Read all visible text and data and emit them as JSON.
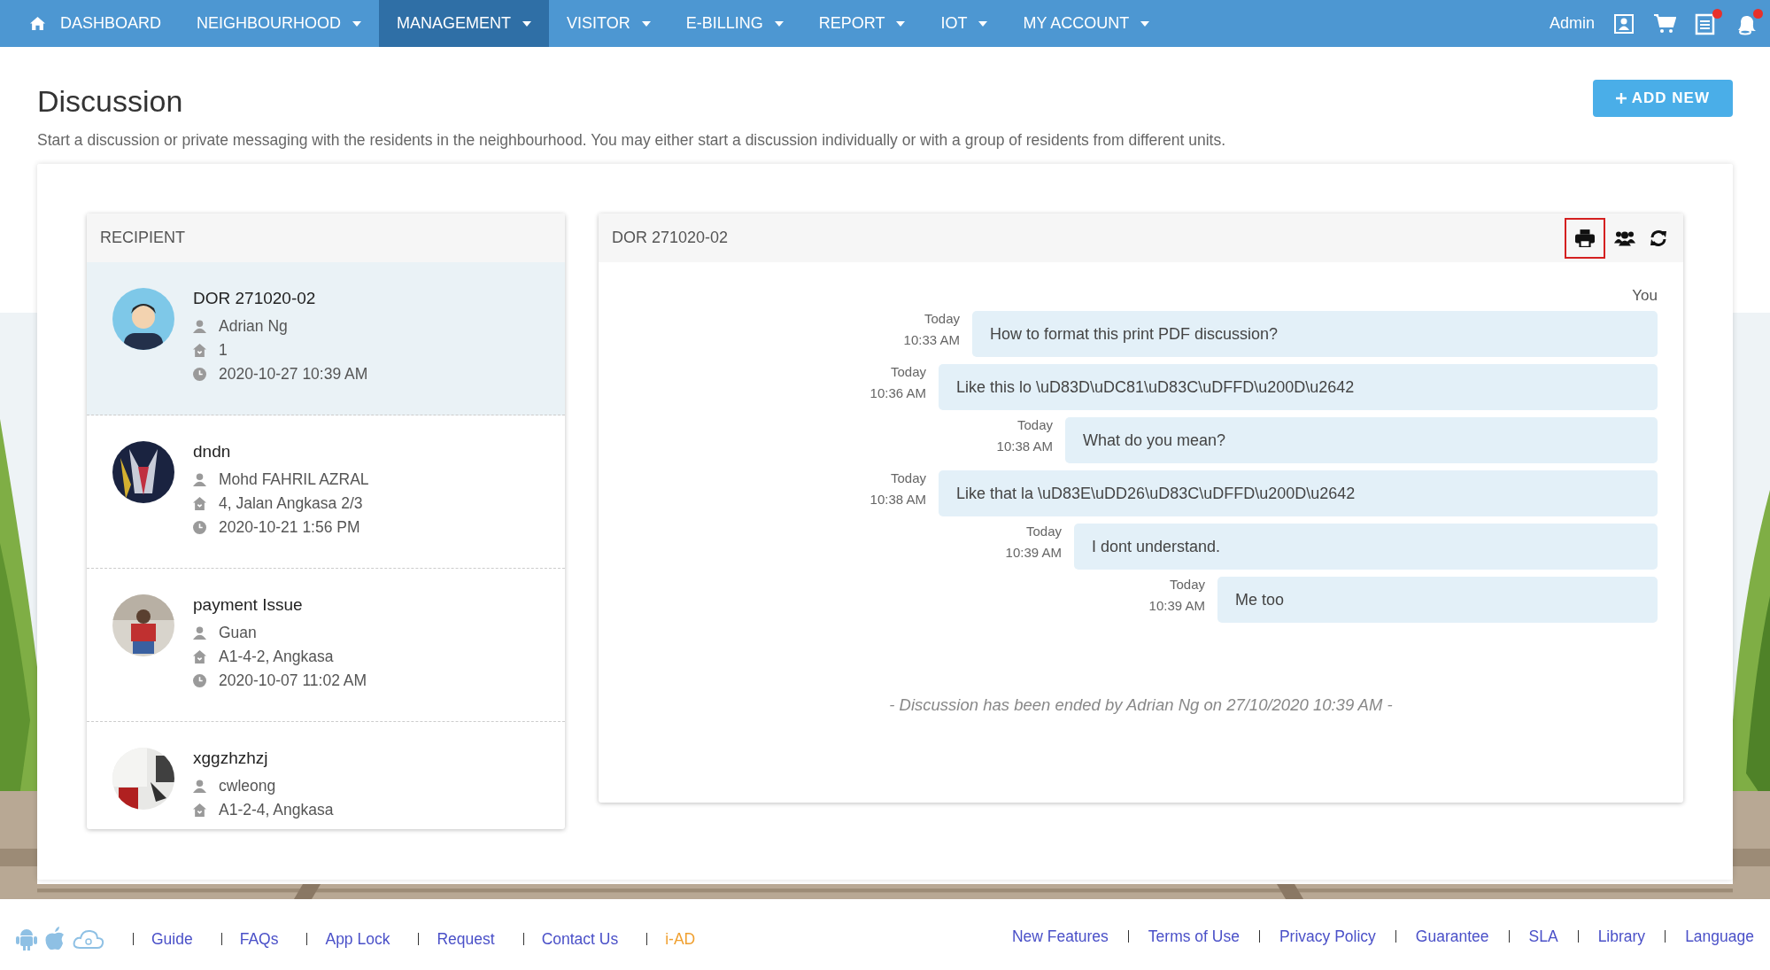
{
  "nav": {
    "items": [
      {
        "label": "DASHBOARD",
        "kind": "home",
        "dropdown": false,
        "selected": false
      },
      {
        "label": "NEIGHBOURHOOD",
        "dropdown": true,
        "selected": false
      },
      {
        "label": "MANAGEMENT",
        "dropdown": true,
        "selected": true
      },
      {
        "label": "VISITOR",
        "dropdown": true,
        "selected": false
      },
      {
        "label": "E-BILLING",
        "dropdown": true,
        "selected": false
      },
      {
        "label": "REPORT",
        "dropdown": true,
        "selected": false
      },
      {
        "label": "IOT",
        "dropdown": true,
        "selected": false
      },
      {
        "label": "MY ACCOUNT",
        "dropdown": true,
        "selected": false
      }
    ],
    "user": "Admin",
    "tools": [
      {
        "kind": "profile",
        "alert": false
      },
      {
        "kind": "cart",
        "alert": false
      },
      {
        "kind": "notes",
        "alert": true
      },
      {
        "kind": "bell",
        "alert": true
      }
    ]
  },
  "page": {
    "title": "Discussion",
    "add_button": "ADD NEW",
    "description": "Start a discussion or private messaging with the residents in the neighbourhood. You may either start a discussion individually or with a group of residents from different units."
  },
  "recipients": {
    "header": "RECIPIENT",
    "items": [
      {
        "title": "DOR 271020-02",
        "name": "Adrian Ng",
        "unit": "1",
        "time": "2020-10-27 10:39 AM",
        "selected": true,
        "kind": "picture"
      },
      {
        "title": "dndn",
        "name": "Mohd FAHRIL AZRAL",
        "unit": "4, Jalan Angkasa 2/3",
        "time": "2020-10-21 1:56 PM",
        "selected": false,
        "kind": "picture"
      },
      {
        "title": "payment Issue",
        "name": "Guan",
        "unit": "A1-4-2, Angkasa",
        "time": "2020-10-07 11:02 AM",
        "selected": false,
        "kind": "picture"
      },
      {
        "title": "xggzhzhzj",
        "name": "cwleong",
        "unit": "A1-2-4, Angkasa",
        "selected": false,
        "kind": "picture"
      }
    ]
  },
  "chat": {
    "title": "DOR 271020-02",
    "tools": [
      {
        "kind": "print",
        "selected": true
      },
      {
        "kind": "group",
        "selected": false
      },
      {
        "kind": "refresh",
        "selected": false
      }
    ],
    "sender": "You",
    "messages": [
      {
        "day": "Today",
        "time": "10:33 AM",
        "text": "How to format this print PDF discussion?"
      },
      {
        "day": "Today",
        "time": "10:36 AM",
        "text": "Like this lo \\uD83D\\uDC81\\uD83C\\uDFFD\\u200D\\u2642"
      },
      {
        "day": "Today",
        "time": "10:38 AM",
        "text": "What do you mean?"
      },
      {
        "day": "Today",
        "time": "10:38 AM",
        "text": "Like that la \\uD83E\\uDD26\\uD83C\\uDFFD\\u200D\\u2642"
      },
      {
        "day": "Today",
        "time": "10:39 AM",
        "text": "I dont understand."
      },
      {
        "day": "Today",
        "time": "10:39 AM",
        "text": "Me too"
      }
    ],
    "ended": "- Discussion has been ended by Adrian Ng on 27/10/2020 10:39 AM -"
  },
  "footer": {
    "apps": [
      {
        "kind": "android"
      },
      {
        "kind": "apple"
      },
      {
        "kind": "cloud"
      }
    ],
    "left_links": [
      {
        "label": "Guide",
        "color": "#4a50c8"
      },
      {
        "label": "FAQs",
        "color": "#4a50c8"
      },
      {
        "label": "App Lock",
        "color": "#4a50c8"
      },
      {
        "label": "Request",
        "color": "#4a50c8"
      },
      {
        "label": "Contact Us",
        "color": "#4a50c8"
      },
      {
        "label": "i-AD",
        "color": "#f0a030"
      }
    ],
    "right_links": [
      {
        "label": "New Features"
      },
      {
        "label": "Terms of Use"
      },
      {
        "label": "Privacy Policy"
      },
      {
        "label": "Guarantee"
      },
      {
        "label": "SLA"
      },
      {
        "label": "Library"
      },
      {
        "label": "Language"
      }
    ]
  }
}
